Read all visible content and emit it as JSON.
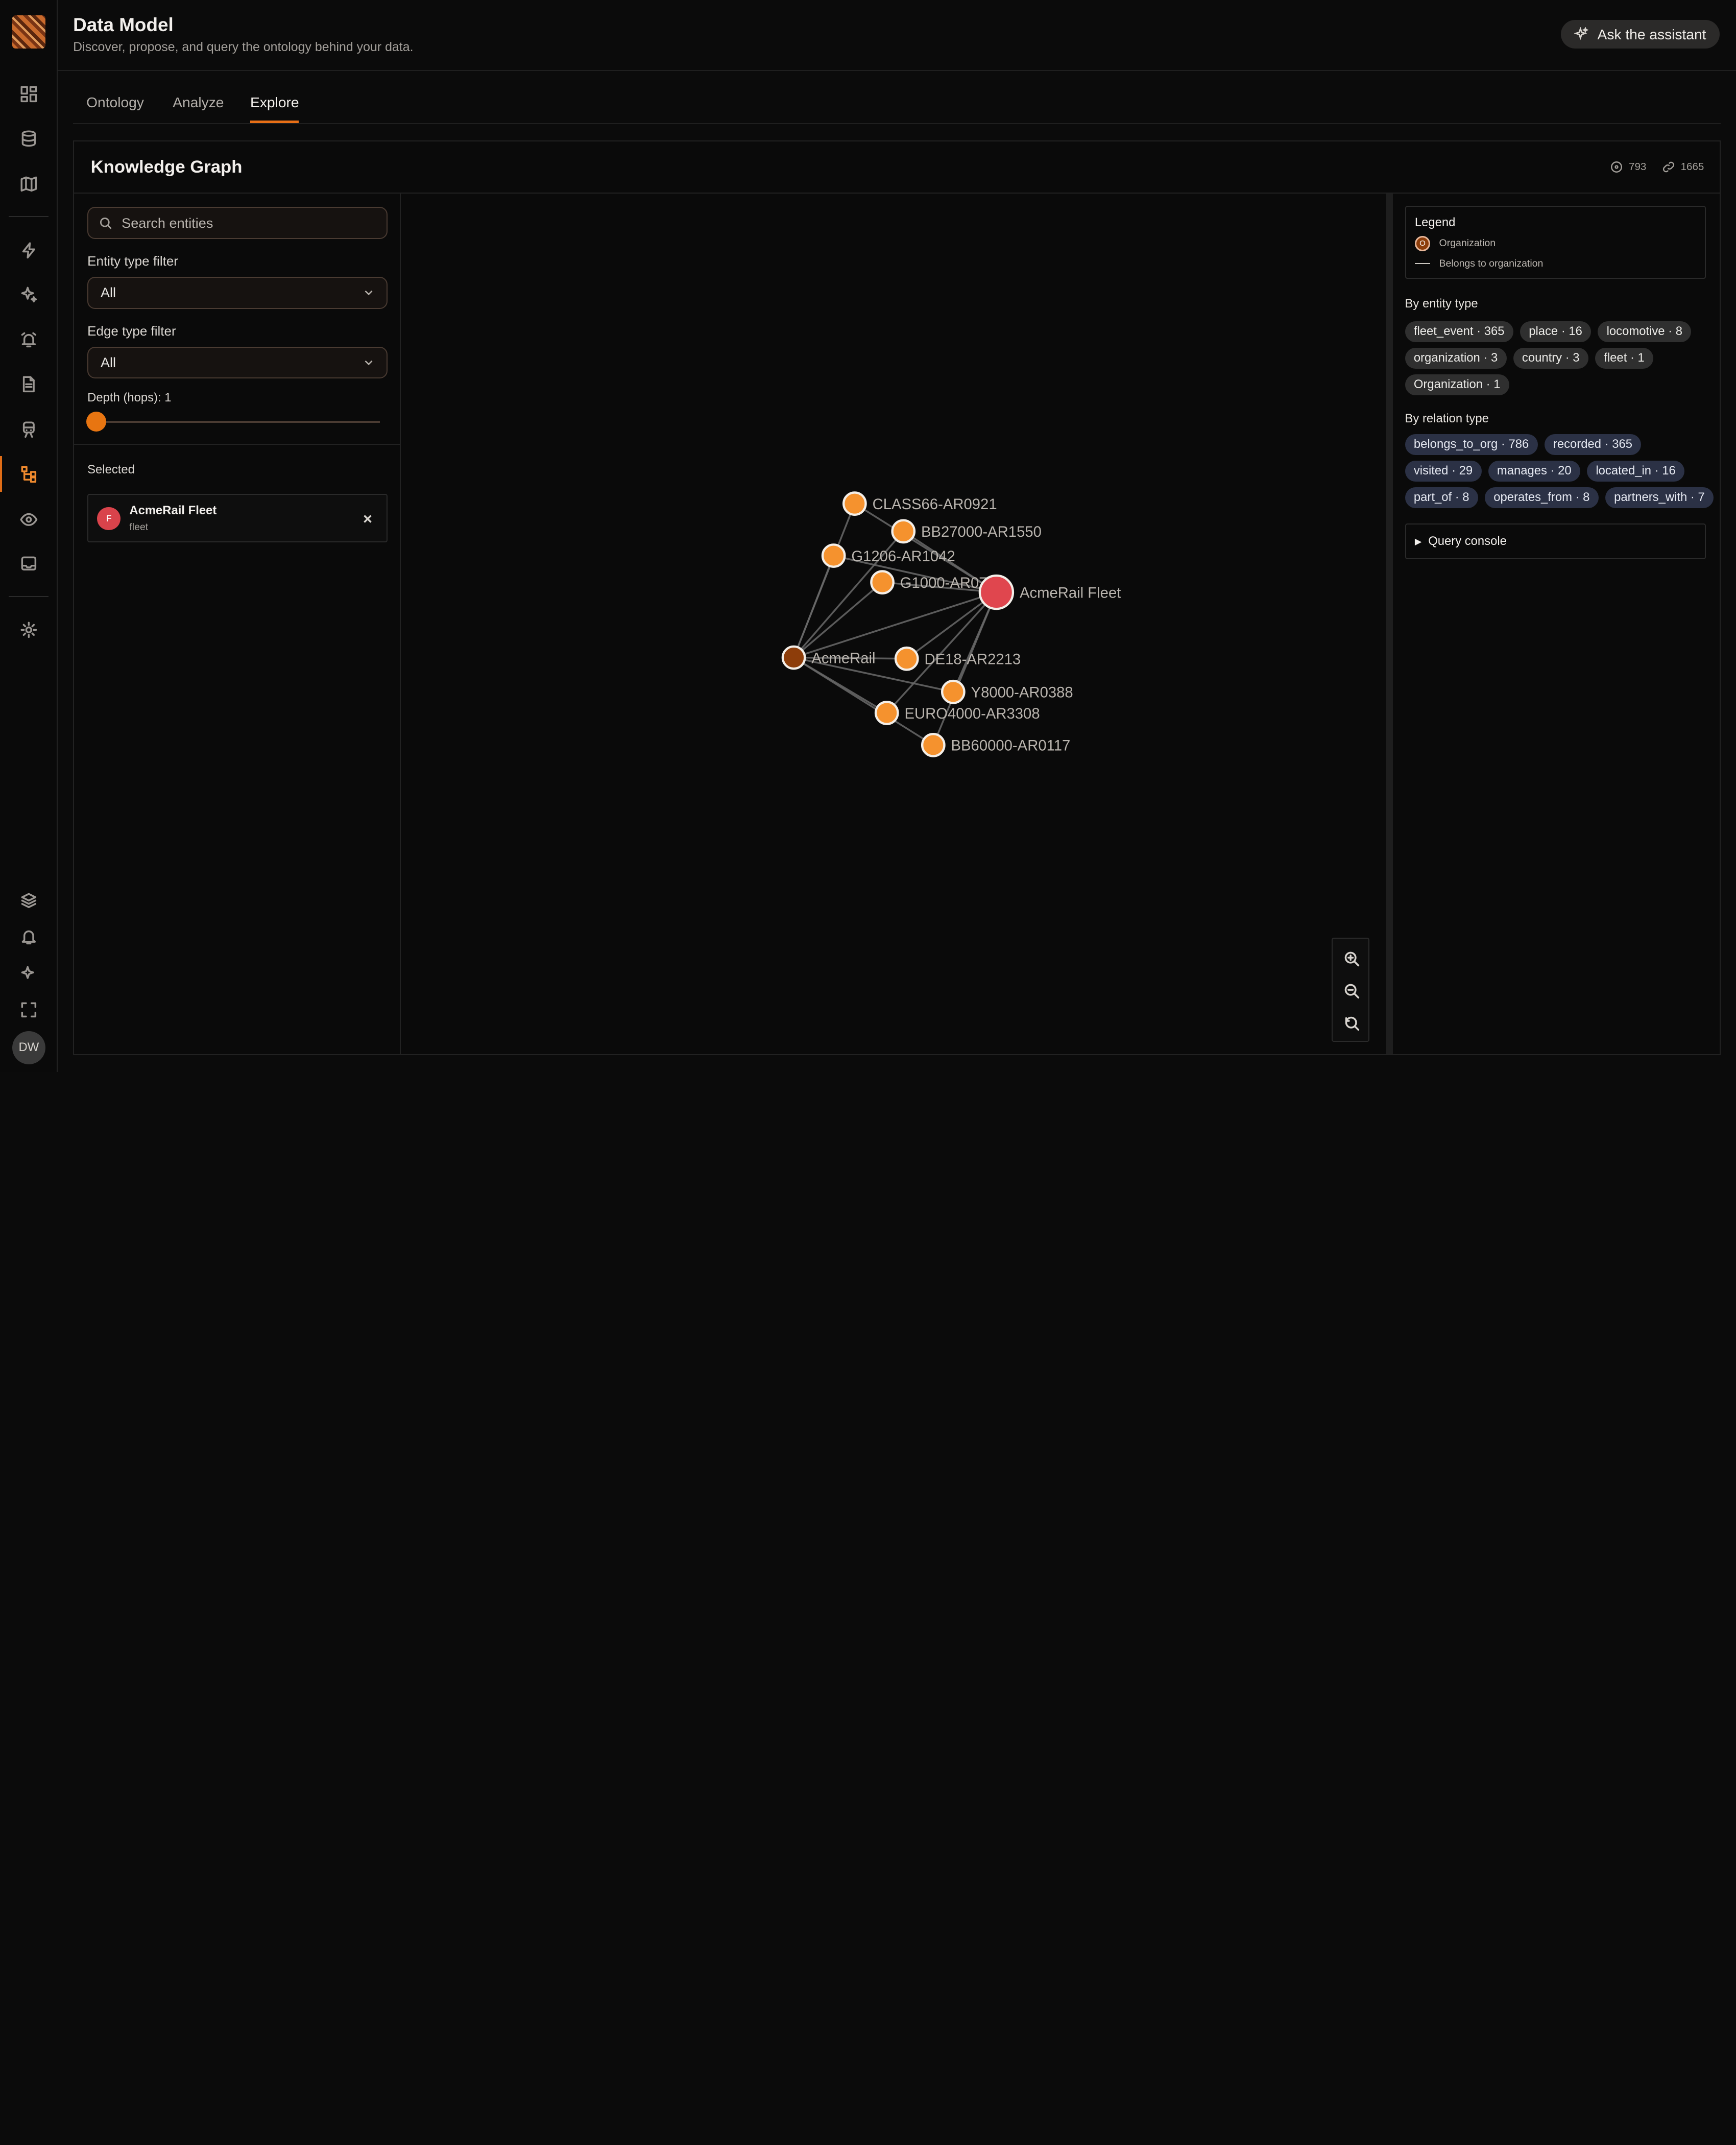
{
  "app": {
    "title": "Data Model",
    "subtitle": "Discover, propose, and query the ontology behind your data.",
    "assistant_label": "Ask the assistant",
    "user_initials": "DW"
  },
  "tabs": [
    {
      "label": "Ontology",
      "active": false
    },
    {
      "label": "Analyze",
      "active": false
    },
    {
      "label": "Explore",
      "active": true
    }
  ],
  "graph_card": {
    "title": "Knowledge Graph",
    "node_count": "793",
    "edge_count": "1665"
  },
  "filters": {
    "search_placeholder": "Search entities",
    "entity_type_label": "Entity type filter",
    "entity_type_value": "All",
    "edge_type_label": "Edge type filter",
    "edge_type_value": "All",
    "depth_label": "Depth (hops): 1",
    "depth_value": 1
  },
  "selected": {
    "label": "Selected",
    "badge": "F",
    "name": "AcmeRail Fleet",
    "type": "fleet"
  },
  "legend": {
    "title": "Legend",
    "node_badge": "O",
    "node_label": "Organization",
    "edge_label": "Belongs to organization"
  },
  "entity_types": {
    "title": "By entity type",
    "items": [
      "fleet_event · 365",
      "place · 16",
      "locomotive · 8",
      "organization · 3",
      "country · 3",
      "fleet · 1",
      "Organization · 1"
    ]
  },
  "relation_types": {
    "title": "By relation type",
    "items": [
      "belongs_to_org · 786",
      "recorded · 365",
      "visited · 29",
      "manages · 20",
      "located_in · 16",
      "part_of · 8",
      "operates_from · 8",
      "partners_with · 7"
    ]
  },
  "query_console": "Query console",
  "graph": {
    "colors": {
      "locomotive": "#f5922e",
      "fleet": "#e0464e",
      "organization": "#8d3d0a",
      "edge": "#6a6a6a",
      "node_stroke": "#f3eee8",
      "label": "#b9b4ae"
    },
    "nodes": [
      {
        "id": "CLASS66-AR0921",
        "label": "CLASS66-AR0921",
        "kind": "locomotive"
      },
      {
        "id": "BB27000-AR1550",
        "label": "BB27000-AR1550",
        "kind": "locomotive"
      },
      {
        "id": "G1206-AR1042",
        "label": "G1206-AR1042",
        "kind": "locomotive"
      },
      {
        "id": "G1000-AR0704",
        "label": "G1000-AR0704",
        "kind": "locomotive"
      },
      {
        "id": "AcmeRail Fleet",
        "label": "AcmeRail Fleet",
        "kind": "fleet"
      },
      {
        "id": "AcmeRail",
        "label": "AcmeRail",
        "kind": "organization"
      },
      {
        "id": "DE18-AR2213",
        "label": "DE18-AR2213",
        "kind": "locomotive"
      },
      {
        "id": "Y8000-AR0388",
        "label": "Y8000-AR0388",
        "kind": "locomotive"
      },
      {
        "id": "EURO4000-AR3308",
        "label": "EURO4000-AR3308",
        "kind": "locomotive"
      },
      {
        "id": "BB60000-AR0117",
        "label": "BB60000-AR0117",
        "kind": "locomotive"
      }
    ],
    "edges": [
      [
        "CLASS66-AR0921",
        "AcmeRail Fleet"
      ],
      [
        "BB27000-AR1550",
        "AcmeRail Fleet"
      ],
      [
        "G1206-AR1042",
        "AcmeRail Fleet"
      ],
      [
        "G1000-AR0704",
        "AcmeRail Fleet"
      ],
      [
        "DE18-AR2213",
        "AcmeRail Fleet"
      ],
      [
        "Y8000-AR0388",
        "AcmeRail Fleet"
      ],
      [
        "EURO4000-AR3308",
        "AcmeRail Fleet"
      ],
      [
        "BB60000-AR0117",
        "AcmeRail Fleet"
      ],
      [
        "AcmeRail",
        "AcmeRail Fleet"
      ],
      [
        "AcmeRail",
        "CLASS66-AR0921"
      ],
      [
        "AcmeRail",
        "BB27000-AR1550"
      ],
      [
        "AcmeRail",
        "G1206-AR1042"
      ],
      [
        "AcmeRail",
        "G1000-AR0704"
      ],
      [
        "AcmeRail",
        "DE18-AR2213"
      ],
      [
        "AcmeRail",
        "Y8000-AR0388"
      ],
      [
        "AcmeRail",
        "EURO4000-AR3308"
      ],
      [
        "AcmeRail",
        "BB60000-AR0117"
      ]
    ]
  }
}
